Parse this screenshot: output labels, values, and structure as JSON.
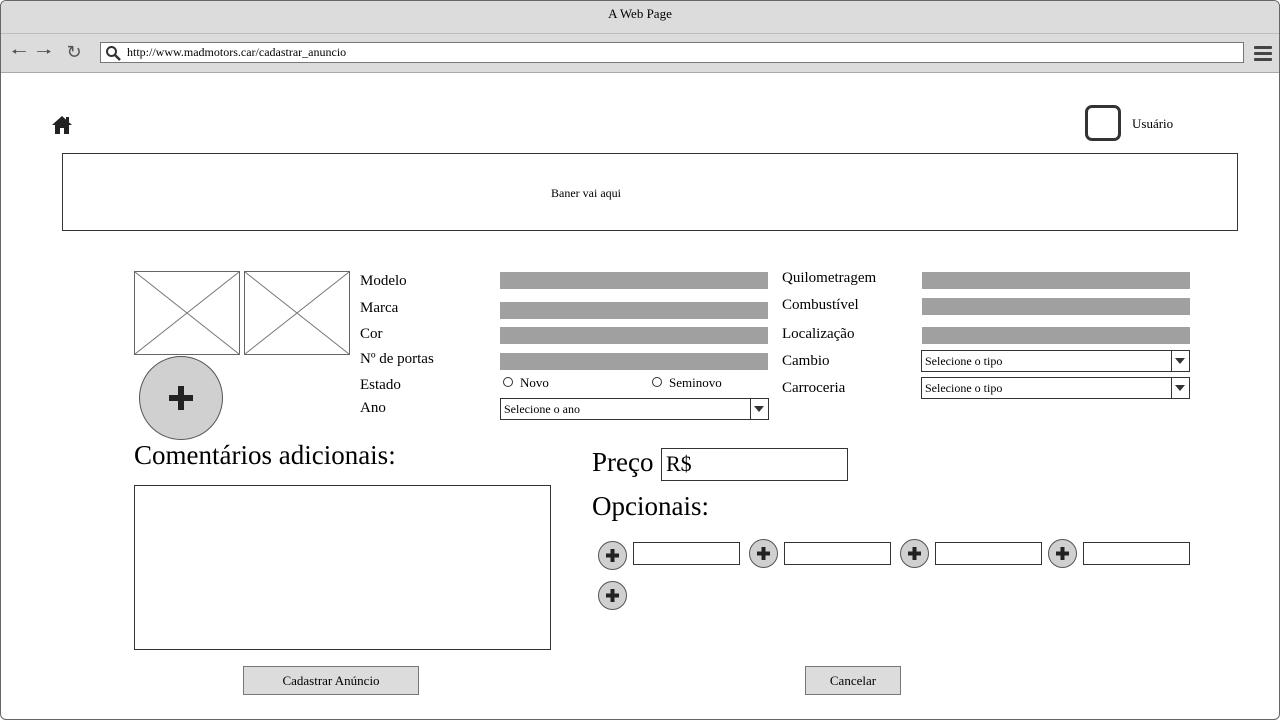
{
  "window": {
    "title": "A Web Page"
  },
  "browser": {
    "url": "http://www.madmotors.car/cadastrar_anuncio",
    "back_icon": "arrow-left-icon",
    "forward_icon": "arrow-right-icon",
    "reload_icon": "reload-icon",
    "menu_icon": "hamburger-menu-icon"
  },
  "header": {
    "home_icon": "home-icon",
    "user_label": "Usuário"
  },
  "banner": {
    "text": "Baner vai aqui"
  },
  "form": {
    "labels": {
      "modelo": "Modelo",
      "marca": "Marca",
      "cor": "Cor",
      "portas": "Nº de portas",
      "estado": "Estado",
      "ano": "Ano",
      "quilometragem": "Quilometragem",
      "combustivel": "Combustível",
      "localizacao": "Localização",
      "cambio": "Cambio",
      "carroceria": "Carroceria"
    },
    "estado_options": [
      "Novo",
      "Seminovo"
    ],
    "ano_select": "Selecione o ano",
    "cambio_select": "Selecione o tipo",
    "carroceria_select": "Selecione o tipo",
    "comments_label": "Comentários adicionais:",
    "price_label": "Preço",
    "price_value": "R$",
    "optionals_label": "Opcionais:"
  },
  "actions": {
    "submit": "Cadastrar Anúncio",
    "cancel": "Cancelar"
  },
  "colors": {
    "chrome": "#dcdcdc",
    "field_fill": "#a0a0a0",
    "button_circle": "#d0d0d0"
  }
}
